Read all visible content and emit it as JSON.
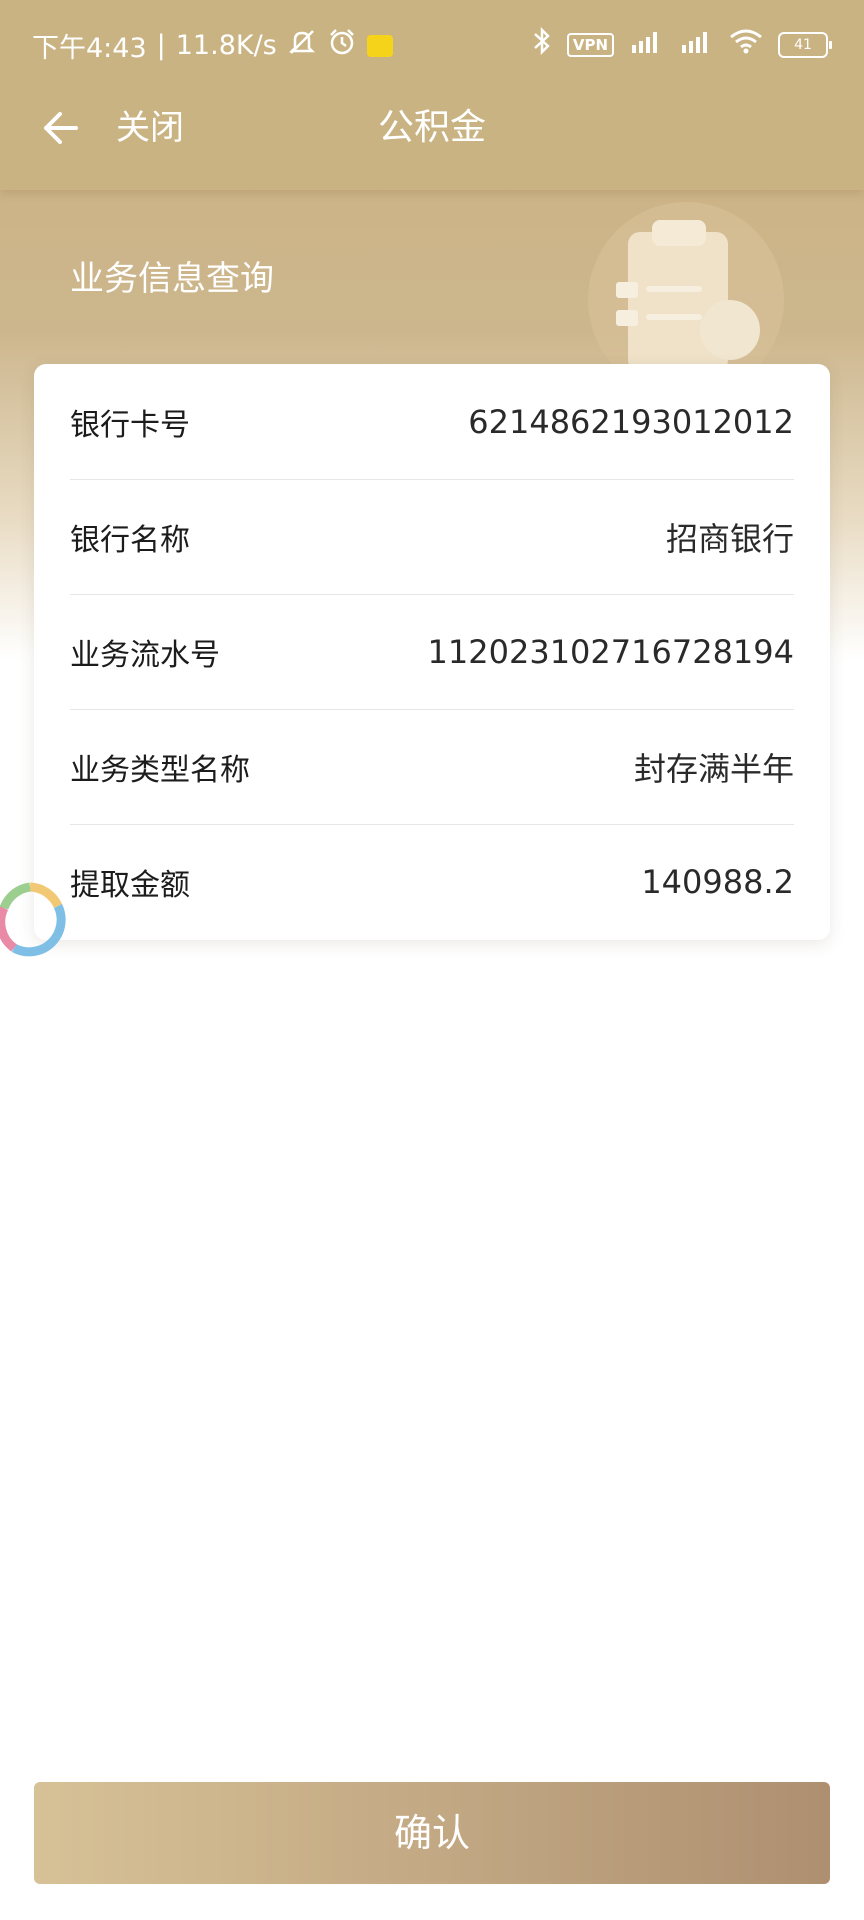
{
  "status_bar": {
    "time": "下午4:43",
    "speed": "11.8K/s",
    "vpn": "VPN",
    "battery": "41"
  },
  "nav": {
    "close_label": "关闭",
    "title": "公积金"
  },
  "section_title": "业务信息查询",
  "details": [
    {
      "label": "银行卡号",
      "value": "6214862193012012"
    },
    {
      "label": "银行名称",
      "value": "招商银行"
    },
    {
      "label": "业务流水号",
      "value": "112023102716728194"
    },
    {
      "label": "业务类型名称",
      "value": "封存满半年"
    },
    {
      "label": "提取金额",
      "value": "140988.2"
    }
  ],
  "confirm_label": "确认",
  "colors": {
    "header": "#cab383",
    "accent_start": "#d7c197",
    "accent_end": "#ae9070"
  }
}
